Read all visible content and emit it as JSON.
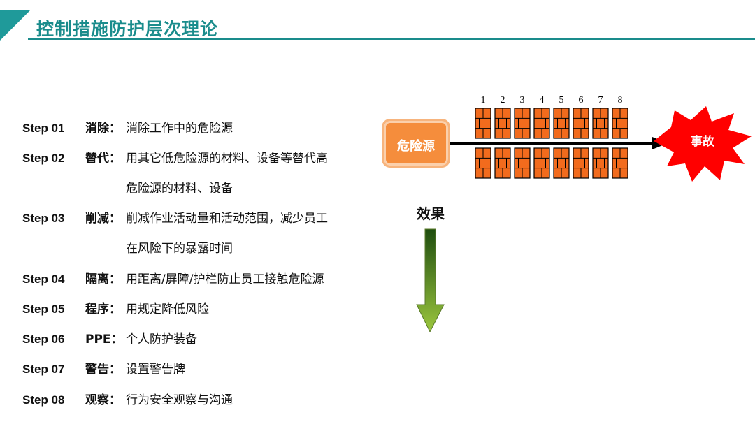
{
  "title": "控制措施防护层次理论",
  "steps": [
    {
      "no": "Step 01",
      "key": "消除：",
      "desc": "消除工作中的危险源",
      "cont": ""
    },
    {
      "no": "Step 02",
      "key": "替代：",
      "desc": "用其它低危险源的材料、设备等替代高",
      "cont": "危险源的材料、设备"
    },
    {
      "no": "Step 03",
      "key": "削减：",
      "desc": "削减作业活动量和活动范围，减少员工",
      "cont": "在风险下的暴露时间"
    },
    {
      "no": "Step 04",
      "key": "隔离：",
      "desc": "用距离/屏障/护栏防止员工接触危险源",
      "cont": ""
    },
    {
      "no": "Step 05",
      "key": "程序：",
      "desc": "用规定降低风险",
      "cont": ""
    },
    {
      "no": "Step 06",
      "key": "PPE：",
      "desc": "个人防护装备",
      "cont": ""
    },
    {
      "no": "Step 07",
      "key": "警告：",
      "desc": "设置警告牌",
      "cont": ""
    },
    {
      "no": "Step 08",
      "key": "观察：",
      "desc": "行为安全观察与沟通",
      "cont": ""
    }
  ],
  "diagram": {
    "hazard": "危险源",
    "accident": "事故",
    "effect": "效果",
    "layer_numbers": [
      "1",
      "2",
      "3",
      "4",
      "5",
      "6",
      "7",
      "8"
    ]
  },
  "colors": {
    "teal": "#1a8c8c",
    "orange": "#f58d3c",
    "brick": "#f26b1d",
    "red": "#ff0000",
    "green": "#5a8a1a"
  }
}
